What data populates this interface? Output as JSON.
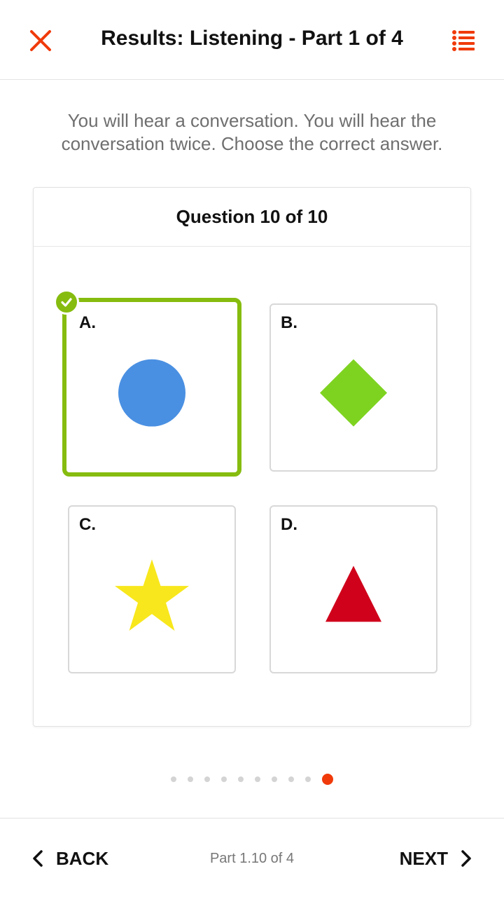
{
  "header": {
    "title": "Results: Listening - Part 1 of 4",
    "close_icon": "close-icon",
    "list_icon": "list-icon",
    "accent_color": "#f03a0a"
  },
  "instructions": "You will hear a conversation. You will hear the conversation twice. Choose the correct answer.",
  "question": {
    "header": "Question 10 of 10",
    "options": [
      {
        "label": "A.",
        "shape": "circle",
        "color": "#4a90e2",
        "selected": true,
        "correct": true
      },
      {
        "label": "B.",
        "shape": "diamond",
        "color": "#7ed321",
        "selected": false
      },
      {
        "label": "C.",
        "shape": "star",
        "color": "#f8e71c",
        "selected": false
      },
      {
        "label": "D.",
        "shape": "triangle",
        "color": "#d0021b",
        "selected": false
      }
    ],
    "selected_border_color": "#86bc0f"
  },
  "pagination": {
    "total": 10,
    "current": 10,
    "active_color": "#f03a0a"
  },
  "footer": {
    "back_label": "BACK",
    "next_label": "NEXT",
    "progress_label": "Part 1.10 of 4"
  }
}
